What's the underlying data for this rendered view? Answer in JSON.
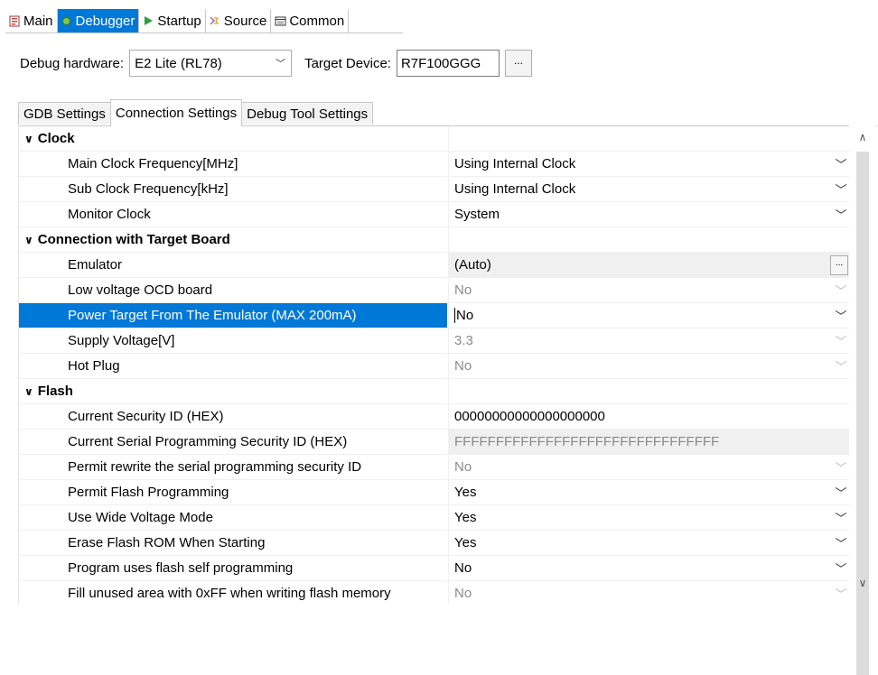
{
  "top_tabs": [
    {
      "label": "Main",
      "icon": "main-tab-icon"
    },
    {
      "label": "Debugger",
      "icon": "debugger-icon"
    },
    {
      "label": "Startup",
      "icon": "play-icon"
    },
    {
      "label": "Source",
      "icon": "source-icon"
    },
    {
      "label": "Common",
      "icon": "common-icon"
    }
  ],
  "hardware": {
    "debug_hardware_label": "Debug hardware:",
    "debug_hardware_value": "E2 Lite (RL78)",
    "target_device_label": "Target Device:",
    "target_device_value": "R7F100GGG",
    "browse_label": "..."
  },
  "inner_tabs": [
    "GDB Settings",
    "Connection Settings",
    "Debug Tool Settings"
  ],
  "rows": [
    {
      "type": "cat",
      "name": "Clock"
    },
    {
      "type": "prop",
      "name": "Main Clock Frequency[MHz]",
      "value": "Using Internal Clock"
    },
    {
      "type": "prop",
      "name": "Sub Clock Frequency[kHz]",
      "value": "Using Internal Clock"
    },
    {
      "type": "prop",
      "name": "Monitor Clock",
      "value": "System"
    },
    {
      "type": "cat",
      "name": "Connection with Target Board"
    },
    {
      "type": "prop",
      "name": "Emulator",
      "value": "(Auto)",
      "button": "..."
    },
    {
      "type": "prop",
      "name": "Low voltage OCD board",
      "value": "No"
    },
    {
      "type": "prop",
      "name": "Power Target From The Emulator (MAX 200mA)",
      "value": "No"
    },
    {
      "type": "prop",
      "name": "Supply Voltage[V]",
      "value": "3.3"
    },
    {
      "type": "prop",
      "name": "Hot Plug",
      "value": "No"
    },
    {
      "type": "cat",
      "name": "Flash"
    },
    {
      "type": "prop",
      "name": "Current Security ID (HEX)",
      "value": "00000000000000000000"
    },
    {
      "type": "prop",
      "name": "Current Serial Programming Security ID (HEX)",
      "value": "FFFFFFFFFFFFFFFFFFFFFFFFFFFFFFFF"
    },
    {
      "type": "prop",
      "name": "Permit rewrite the serial programming security ID",
      "value": "No"
    },
    {
      "type": "prop",
      "name": "Permit Flash Programming",
      "value": "Yes"
    },
    {
      "type": "prop",
      "name": "Use Wide Voltage Mode",
      "value": "Yes"
    },
    {
      "type": "prop",
      "name": "Erase Flash ROM When Starting",
      "value": "Yes"
    },
    {
      "type": "prop",
      "name": "Program uses flash self programming",
      "value": "No"
    },
    {
      "type": "prop",
      "name": "Fill unused area with 0xFF when writing flash memory",
      "value": "No"
    }
  ]
}
